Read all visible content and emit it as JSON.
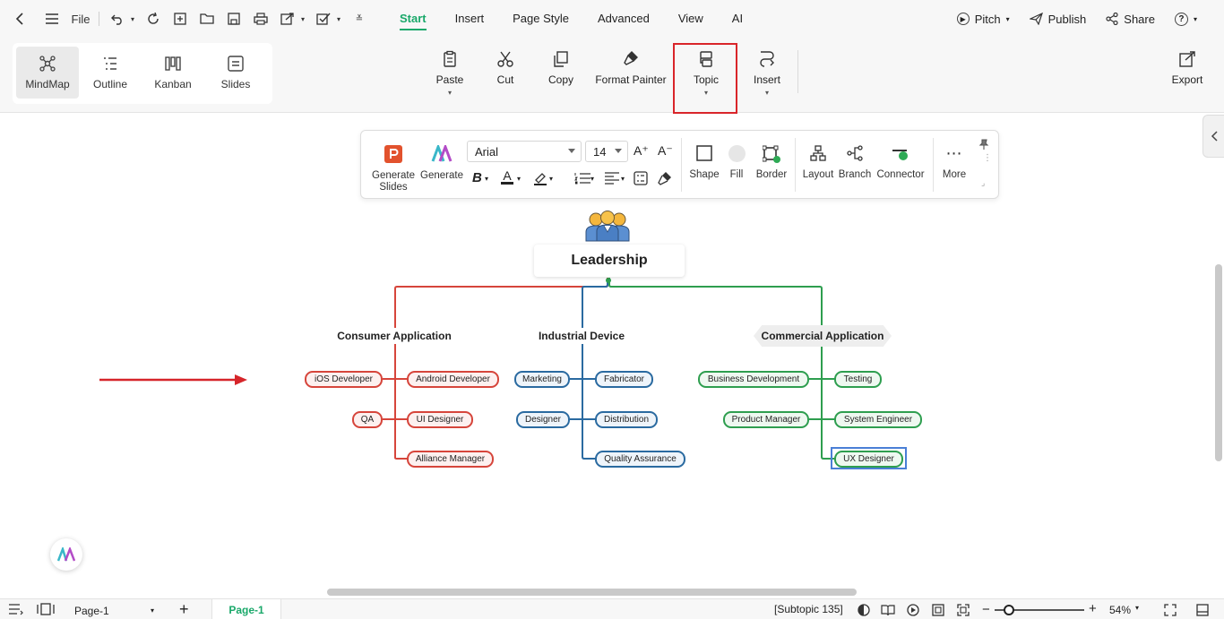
{
  "titlebar": {
    "file_label": "File",
    "menu_tabs": [
      "Start",
      "Insert",
      "Page Style",
      "Advanced",
      "View",
      "AI"
    ],
    "pitch_label": "Pitch",
    "publish_label": "Publish",
    "share_label": "Share",
    "help_icon": "?"
  },
  "ribbon": {
    "views": [
      "MindMap",
      "Outline",
      "Kanban",
      "Slides"
    ],
    "tools": {
      "paste": "Paste",
      "cut": "Cut",
      "copy": "Copy",
      "format_painter": "Format Painter",
      "topic": "Topic",
      "insert": "Insert",
      "export": "Export"
    }
  },
  "floatbar": {
    "generate_slides": "Generate Slides",
    "generate": "Generate",
    "font": "Arial",
    "size": "14",
    "shape": "Shape",
    "fill": "Fill",
    "border": "Border",
    "layout": "Layout",
    "branch": "Branch",
    "connector": "Connector",
    "more": "More",
    "bold": "B",
    "font_color": "A",
    "grow_font": "A⁺",
    "shrink_font": "A⁻"
  },
  "mindmap": {
    "central": "Leadership",
    "branches": {
      "consumer": "Consumer Application",
      "industrial": "Industrial Device",
      "commercial": "Commercial Application"
    },
    "nodes": {
      "ios": "iOS Developer",
      "android": "Android Developer",
      "qa": "QA",
      "ui": "UI Designer",
      "alliance": "Alliance Manager",
      "marketing": "Marketing",
      "fabricator": "Fabricator",
      "designer": "Designer",
      "distribution": "Distribution",
      "quality": "Quality Assurance",
      "bizdev": "Business Development",
      "testing": "Testing",
      "product": "Product Manager",
      "syseng": "System Engineer",
      "ux": "UX Designer"
    },
    "colors": {
      "red": "#d6453b",
      "blue": "#2a6aa0",
      "green": "#2e9e4f"
    }
  },
  "statusbar": {
    "page_select": "Page-1",
    "page_tab": "Page-1",
    "subtopic": "[Subtopic 135]",
    "zoom": "54%"
  }
}
